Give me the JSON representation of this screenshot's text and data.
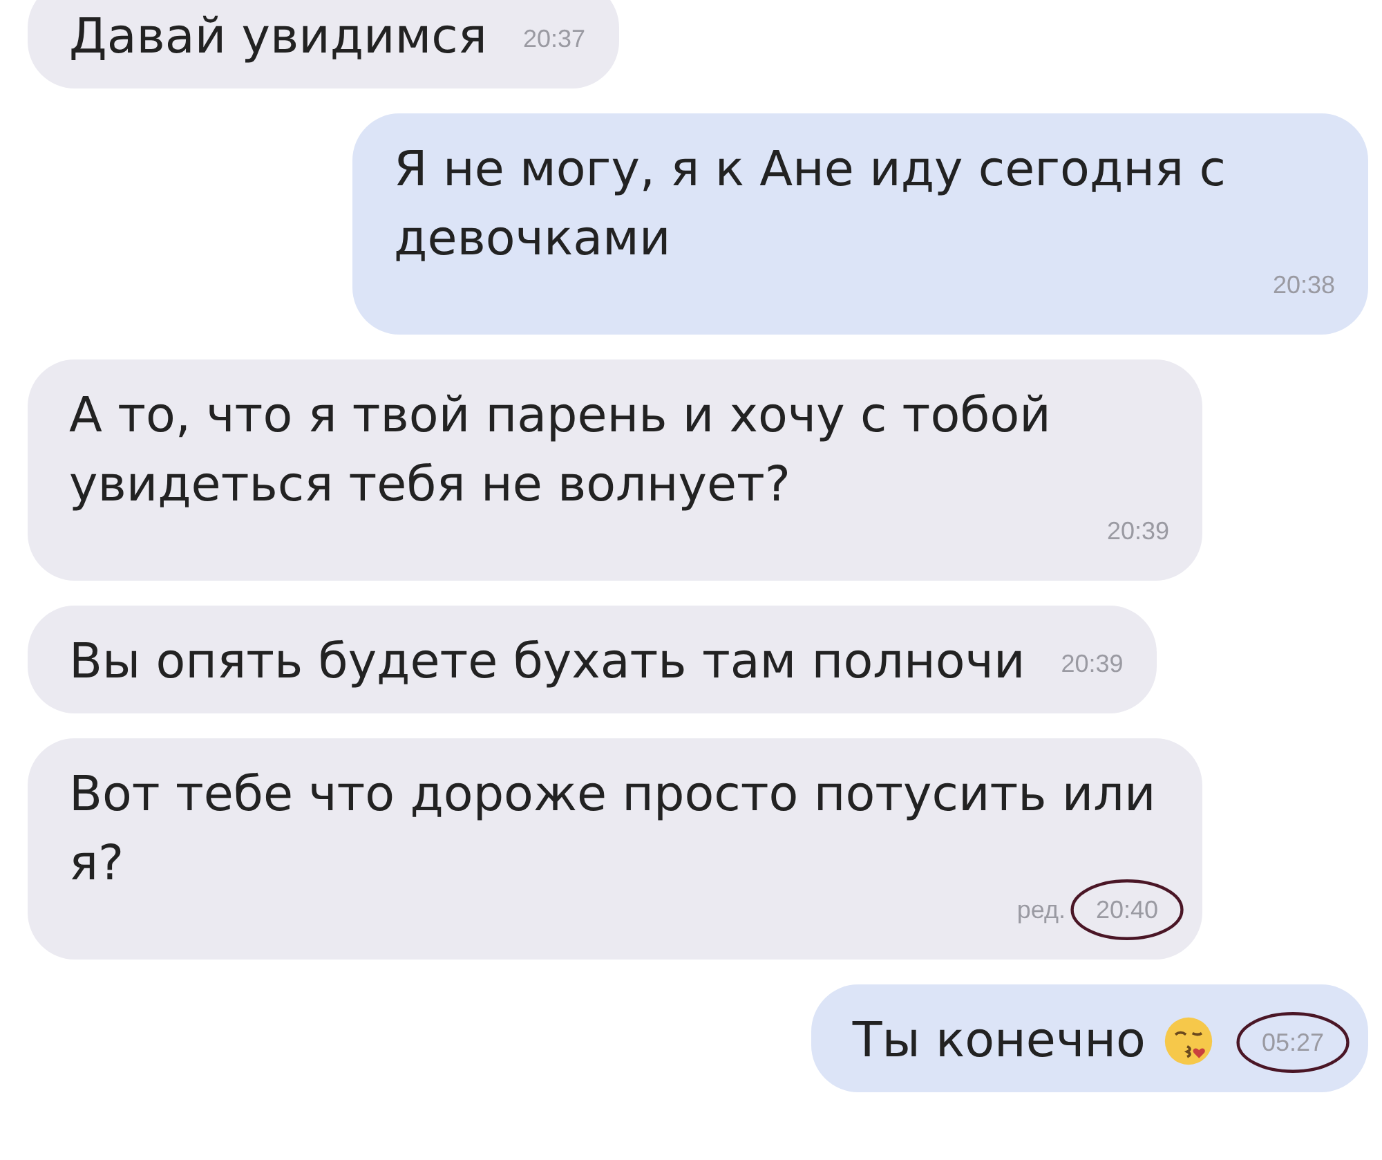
{
  "messages": [
    {
      "kind": "incoming",
      "text": "Давай увидимся",
      "time": "20:37",
      "circled": false
    },
    {
      "kind": "outgoing",
      "text": "Я не могу, я к Ане иду сегодня с девочками",
      "time": "20:38",
      "circled": false
    },
    {
      "kind": "incoming",
      "text": "А то, что я твой парень и хочу с тобой увидеться тебя не волнует?",
      "time": "20:39",
      "circled": false
    },
    {
      "kind": "incoming",
      "text": "Вы опять будете бухать там полночи",
      "time": "20:39",
      "circled": false
    },
    {
      "kind": "incoming",
      "text": "Вот тебе что дороже просто потусить или я?",
      "edited_label": "ред.",
      "time": "20:40",
      "circled": true
    },
    {
      "kind": "outgoing",
      "text": "Ты конечно",
      "emoji": true,
      "time": "05:27",
      "circled": true
    }
  ]
}
